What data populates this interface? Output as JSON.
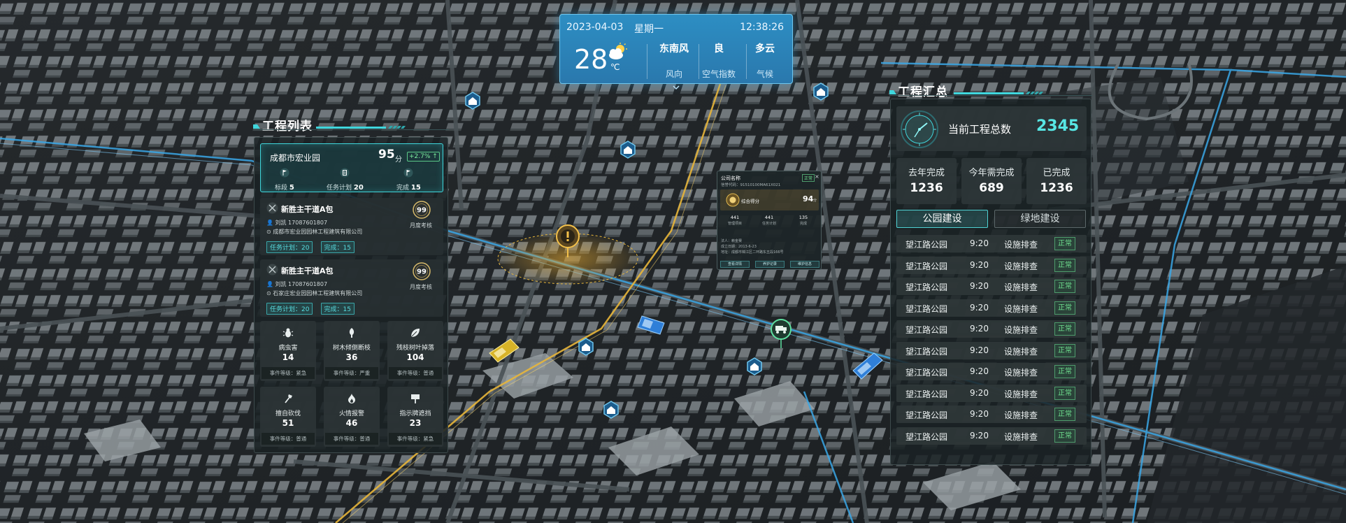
{
  "weather": {
    "date": "2023-04-03",
    "weekday": "星期一",
    "time": "12:38:26",
    "temperature": "28",
    "temp_unit": "℃",
    "wind": {
      "value": "东南风",
      "label": "风向"
    },
    "air": {
      "value": "良",
      "label": "空气指数"
    },
    "climate": {
      "value": "多云",
      "label": "气候"
    }
  },
  "left_panel": {
    "title": "工程列表",
    "top_card": {
      "name": "成都市宏业园",
      "score": "95",
      "score_unit": "分",
      "delta": "+2.7% ↑",
      "stats": [
        {
          "label": "标段",
          "value": "5"
        },
        {
          "label": "任务计划",
          "value": "20"
        },
        {
          "label": "完成",
          "value": "15"
        }
      ]
    },
    "items": [
      {
        "title": "新胜主干道A包",
        "person": "刘凯 17087601807",
        "company": "成都市宏业园园林工程建筑有限公司",
        "plan": "任务计划：20",
        "done": "完成：15",
        "badge": "99",
        "badge_label": "月度考核"
      },
      {
        "title": "新胜主干道A包",
        "person": "刘凯 17087601807",
        "company": "石家庄宏业园园林工程建筑有限公司",
        "plan": "任务计划：20",
        "done": "完成：15",
        "badge": "99",
        "badge_label": "月度考核"
      }
    ],
    "events": [
      {
        "name": "病虫害",
        "count": "14",
        "level": "事件等级：紧急",
        "icon": "bug-icon"
      },
      {
        "name": "树木倾倒断枝",
        "count": "36",
        "level": "事件等级：严重",
        "icon": "tree-icon"
      },
      {
        "name": "残枝树叶掉落",
        "count": "104",
        "level": "事件等级：普通",
        "icon": "leaf-icon"
      },
      {
        "name": "擅自砍伐",
        "count": "51",
        "level": "事件等级：普通",
        "icon": "axe-icon"
      },
      {
        "name": "火情报警",
        "count": "46",
        "level": "事件等级：普通",
        "icon": "fire-icon"
      },
      {
        "name": "指示牌遮挡",
        "count": "23",
        "level": "事件等级：紧急",
        "icon": "sign-icon"
      }
    ]
  },
  "right_panel": {
    "title": "工程汇总",
    "total_label": "当前工程总数",
    "total_value": "2345",
    "summary": [
      {
        "label": "去年完成",
        "value": "1236"
      },
      {
        "label": "今年需完成",
        "value": "689"
      },
      {
        "label": "已完成",
        "value": "1236"
      }
    ],
    "tabs": [
      "公园建设",
      "绿地建设"
    ],
    "rows": [
      {
        "park": "望江路公园",
        "time": "9:20",
        "task": "设施排查",
        "status": "正常"
      },
      {
        "park": "望江路公园",
        "time": "9:20",
        "task": "设施排查",
        "status": "正常"
      },
      {
        "park": "望江路公园",
        "time": "9:20",
        "task": "设施排查",
        "status": "正常"
      },
      {
        "park": "望江路公园",
        "time": "9:20",
        "task": "设施排查",
        "status": "正常"
      },
      {
        "park": "望江路公园",
        "time": "9:20",
        "task": "设施排查",
        "status": "正常"
      },
      {
        "park": "望江路公园",
        "time": "9:20",
        "task": "设施排查",
        "status": "正常"
      },
      {
        "park": "望江路公园",
        "time": "9:20",
        "task": "设施排查",
        "status": "正常"
      },
      {
        "park": "望江路公园",
        "time": "9:20",
        "task": "设施排查",
        "status": "正常"
      },
      {
        "park": "望江路公园",
        "time": "9:20",
        "task": "设施排查",
        "status": "正常"
      },
      {
        "park": "望江路公园",
        "time": "9:20",
        "task": "设施排查",
        "status": "正常"
      }
    ]
  },
  "popup": {
    "title": "公司名称",
    "tag": "正常",
    "close": "×",
    "subtitle": "信誉代码：91510100MA61X021",
    "score_label": "综合得分",
    "score": "94",
    "score_unit": "分",
    "stats": [
      {
        "value": "441",
        "label": "管理项目"
      },
      {
        "value": "441",
        "label": "任务计划"
      },
      {
        "value": "135",
        "label": "完成"
      }
    ],
    "info": [
      "法人：赖金赛",
      "成立日期：2013-6-23",
      "地址：成都市锦江区二环路东五段166号"
    ],
    "buttons": [
      "查看详情",
      "养护记录",
      "维护信息"
    ]
  },
  "colors": {
    "accent": "#3fd6dc",
    "status_ok": "#6fe08f",
    "weather_bg": "#2d8ec3",
    "panel_bg": "#1a2224"
  }
}
